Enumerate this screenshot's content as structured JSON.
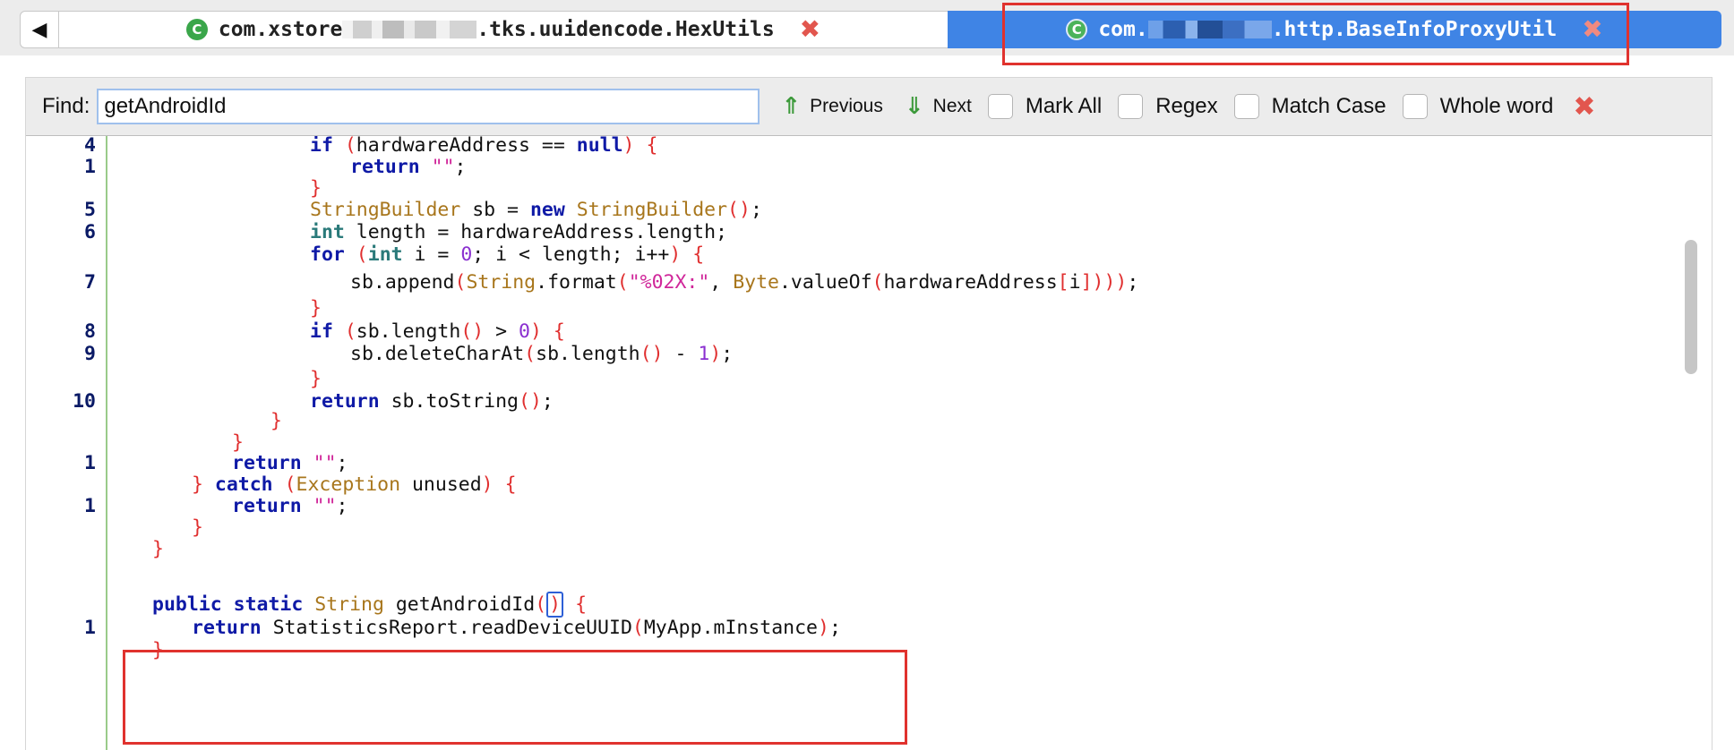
{
  "tabs": [
    {
      "icon": "class-icon",
      "prefix": "com.xstore",
      "suffix": ".tks.uuidencode.HexUtils",
      "active": false
    },
    {
      "icon": "class-icon",
      "prefix": "com.",
      "suffix": ".http.BaseInfoProxyUtil",
      "active": true
    }
  ],
  "find": {
    "label": "Find:",
    "value": "getAndroidId",
    "previous": "Previous",
    "next": "Next",
    "mark_all": "Mark All",
    "regex": "Regex",
    "match_case": "Match Case",
    "whole_word": "Whole word"
  },
  "code_lines": [
    {
      "ln": "4",
      "text": "if (hardwareAddress == null) {"
    },
    {
      "ln": "1",
      "text": "return \"\";"
    },
    {
      "ln": "",
      "text": "}"
    },
    {
      "ln": "5",
      "text": "StringBuilder sb = new StringBuilder();"
    },
    {
      "ln": "6",
      "text": "int length = hardwareAddress.length;"
    },
    {
      "ln": "",
      "text": "for (int i = 0; i < length; i++) {"
    },
    {
      "ln": "7",
      "text": "sb.append(String.format(\"%02X:\", Byte.valueOf(hardwareAddress[i])));"
    },
    {
      "ln": "",
      "text": "}"
    },
    {
      "ln": "8",
      "text": "if (sb.length() > 0) {"
    },
    {
      "ln": "9",
      "text": "sb.deleteCharAt(sb.length() - 1);"
    },
    {
      "ln": "",
      "text": "}"
    },
    {
      "ln": "10",
      "text": "return sb.toString();"
    },
    {
      "ln": "",
      "text": "}"
    },
    {
      "ln": "",
      "text": "}"
    },
    {
      "ln": "1",
      "text": "return \"\";"
    },
    {
      "ln": "",
      "text": "} catch (Exception unused) {"
    },
    {
      "ln": "1",
      "text": "return \"\";"
    },
    {
      "ln": "",
      "text": "}"
    },
    {
      "ln": "",
      "text": "}"
    },
    {
      "ln": "",
      "text": ""
    },
    {
      "ln": "",
      "text": "public static String getAndroidId() {"
    },
    {
      "ln": "1",
      "text": "return StatisticsReport.readDeviceUUID(MyApp.mInstance);"
    },
    {
      "ln": "",
      "text": "}"
    }
  ],
  "colors": {
    "active_tab": "#3f84e5",
    "keyword": "#0f1aa6",
    "type": "#a8761c",
    "brace": "#e02f2f",
    "string": "#d0279a",
    "number": "#8a2fd0",
    "highlight_box": "#e0322e"
  }
}
